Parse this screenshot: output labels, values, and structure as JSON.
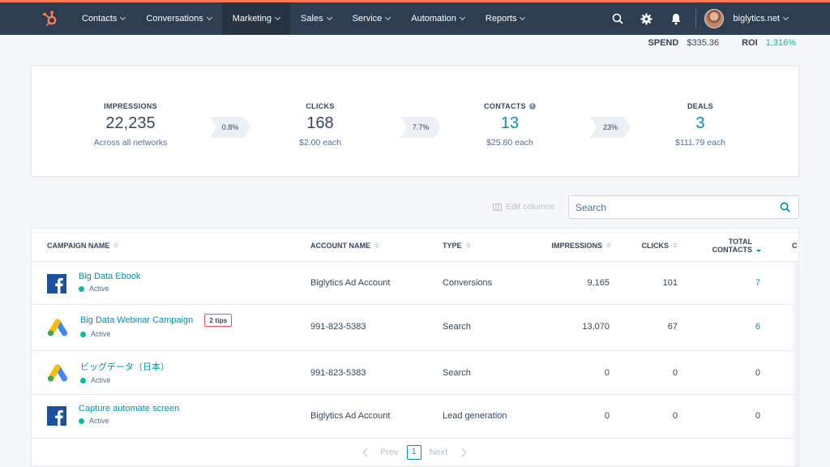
{
  "nav": {
    "items": [
      {
        "label": "Contacts",
        "active": false
      },
      {
        "label": "Conversations",
        "active": false
      },
      {
        "label": "Marketing",
        "active": true
      },
      {
        "label": "Sales",
        "active": false
      },
      {
        "label": "Service",
        "active": false
      },
      {
        "label": "Automation",
        "active": false
      },
      {
        "label": "Reports",
        "active": false
      }
    ],
    "account": "biglytics.net",
    "brand_color": "#ff7a59"
  },
  "summary": {
    "spend_label": "SPEND",
    "spend_value": "$335.36",
    "roi_label": "ROI",
    "roi_value": "1,316%"
  },
  "funnel": {
    "impressions": {
      "label": "IMPRESSIONS",
      "value": "22,235",
      "sub": "Across all networks"
    },
    "rate1": "0.8%",
    "clicks": {
      "label": "CLICKS",
      "value": "168",
      "sub": "$2.00 each"
    },
    "rate2": "7.7%",
    "contacts": {
      "label": "CONTACTS",
      "value": "13",
      "sub": "$25.80 each"
    },
    "rate3": "23%",
    "deals": {
      "label": "DEALS",
      "value": "3",
      "sub": "$111.79 each"
    }
  },
  "toolbar": {
    "edit_columns": "Edit columns",
    "search_placeholder": "Search"
  },
  "table": {
    "headers": {
      "campaign": "CAMPAIGN NAME",
      "account": "ACCOUNT NAME",
      "type": "TYPE",
      "impressions": "IMPRESSIONS",
      "clicks": "CLICKS",
      "total_contacts_1": "TOTAL",
      "total_contacts_2": "CONTACTS",
      "cut": "C"
    },
    "rows": [
      {
        "network": "facebook-icon",
        "name": "Big Data Ebook",
        "status": "Active",
        "account": "Biglytics Ad Account",
        "type": "Conversions",
        "impressions": "9,165",
        "clicks": "101",
        "contacts": "7"
      },
      {
        "network": "google-ads-icon",
        "name": "Big Data Webinar Campaign",
        "tips": "2 tips",
        "status": "Active",
        "account": "991-823-5383",
        "type": "Search",
        "impressions": "13,070",
        "clicks": "67",
        "contacts": "6"
      },
      {
        "network": "google-ads-icon",
        "name": "ビッグデータ（日本）",
        "status": "Active",
        "account": "991-823-5383",
        "type": "Search",
        "impressions": "0",
        "clicks": "0",
        "contacts": "0"
      },
      {
        "network": "facebook-icon",
        "name": "Capture automate screen",
        "status": "Active",
        "account": "Biglytics Ad Account",
        "type": "Lead generation",
        "impressions": "0",
        "clicks": "0",
        "contacts": "0"
      }
    ]
  },
  "pager": {
    "prev": "Prev",
    "page": "1",
    "next": "Next"
  }
}
